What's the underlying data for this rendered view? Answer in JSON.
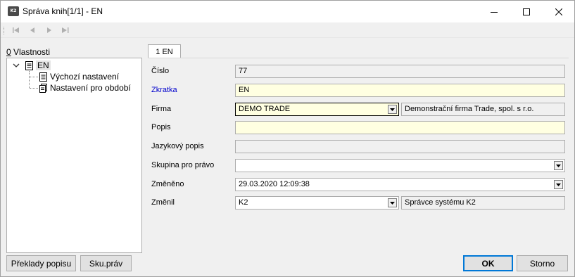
{
  "window": {
    "title": "Správa knih[1/1] - EN",
    "app_icon_text": "K2"
  },
  "left_panel": {
    "label_hotkey": "0",
    "label_rest": " Vlastnosti",
    "tree": {
      "root": "EN",
      "children": [
        "Výchozí nastavení",
        "Nastavení pro období"
      ]
    },
    "buttons": {
      "translations": "Překlady popisu",
      "rights_group": "Sku.práv"
    }
  },
  "tab": {
    "label": "1 EN"
  },
  "form": {
    "cislo": {
      "label": "Číslo",
      "value": "77"
    },
    "zkratka": {
      "label": "Zkratka",
      "value": "EN"
    },
    "firma": {
      "label": "Firma",
      "value": "DEMO TRADE",
      "description": "Demonstrační firma Trade, spol. s r.o."
    },
    "popis": {
      "label": "Popis",
      "value": ""
    },
    "jazykovy_popis": {
      "label": "Jazykový popis",
      "value": ""
    },
    "skupina": {
      "label": "Skupina pro právo",
      "value": ""
    },
    "zmeneno": {
      "label": "Změněno",
      "value": "29.03.2020 12:09:38"
    },
    "zmenil": {
      "label": "Změnil",
      "value": "K2",
      "description": "Správce systému K2"
    }
  },
  "dialog_buttons": {
    "ok": "OK",
    "cancel": "Storno"
  },
  "colors": {
    "required_label": "#0000cc",
    "editable_bg": "#ffffe1",
    "default_button_border": "#0078d7"
  }
}
